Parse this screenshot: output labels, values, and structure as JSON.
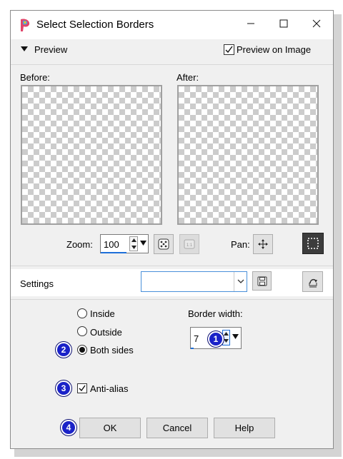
{
  "window": {
    "title": "Select Selection Borders",
    "minimize_icon": "minimize-icon",
    "maximize_icon": "maximize-icon",
    "close_icon": "close-icon"
  },
  "preview": {
    "section_label": "Preview",
    "preview_on_image_label": "Preview on Image",
    "preview_on_image_checked": true,
    "before_label": "Before:",
    "after_label": "After:",
    "zoom_label": "Zoom:",
    "zoom_value": "100",
    "pan_label": "Pan:"
  },
  "settings": {
    "label": "Settings",
    "preset_value": ""
  },
  "options": {
    "inside_label": "Inside",
    "outside_label": "Outside",
    "both_sides_label": "Both sides",
    "selected": "Both sides",
    "border_width_label": "Border width:",
    "border_width_value": "7",
    "anti_alias_label": "Anti-alias",
    "anti_alias_checked": true
  },
  "buttons": {
    "ok": "OK",
    "cancel": "Cancel",
    "help": "Help"
  },
  "badges": [
    "1",
    "2",
    "3",
    "4"
  ],
  "colors": {
    "badge": "#1a22c8",
    "zoom_underline": "#1e6fd9",
    "dark_button": "#3c3c3c"
  }
}
